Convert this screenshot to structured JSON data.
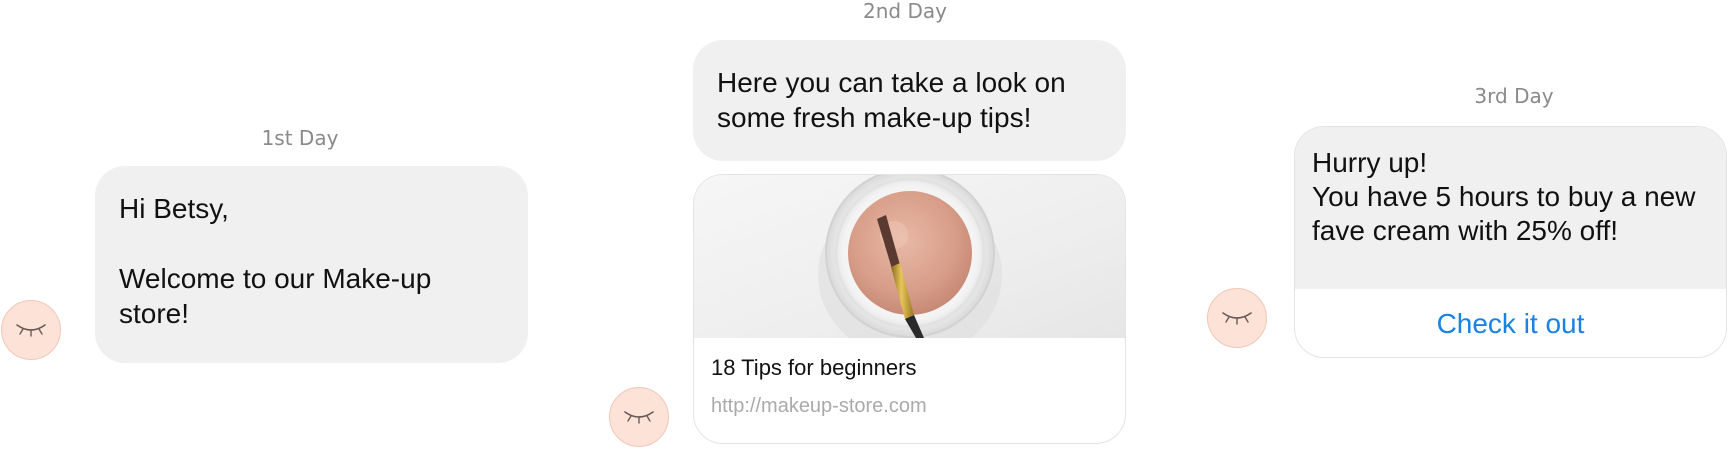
{
  "day1": {
    "label": "1st Day",
    "greeting": "Hi Betsy,",
    "message_line1": "Welcome to our Make-up",
    "message_line2": "store!"
  },
  "day2": {
    "label": "2nd Day",
    "message_line1": "Here you can take a look on",
    "message_line2": "some fresh make-up tips!",
    "card": {
      "title": "18 Tips for beginners",
      "url": "http://makeup-store.com"
    }
  },
  "day3": {
    "label": "3rd Day",
    "message_line1": "Hurry up!",
    "message_line2": "You have 5 hours to buy a new",
    "message_line3": "fave cream with 25% off!",
    "cta_label": "Check it out"
  },
  "avatar_icon": "closed-eye-icon",
  "colors": {
    "bubble_bg": "#f0f0f0",
    "avatar_bg": "#fde2d8",
    "label_text": "#8a8a8a",
    "link_blue": "#1a82e2",
    "url_text": "#aaaaaa"
  }
}
